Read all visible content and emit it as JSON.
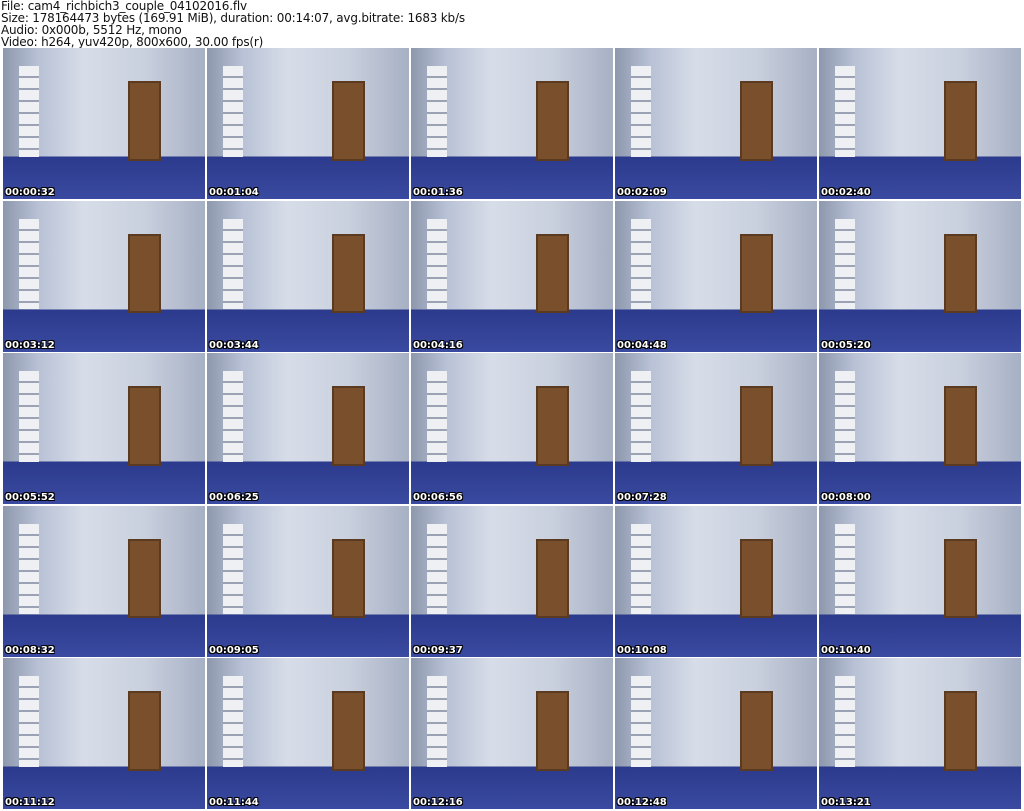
{
  "header": {
    "file": "File: cam4_richbich3_couple_04102016.flv",
    "size": "Size: 178164473 bytes (169.91 MiB), duration: 00:14:07, avg.bitrate: 1683 kb/s",
    "audio": "Audio: 0x000b, 5512 Hz, mono",
    "video": "Video: h264, yuv420p, 800x600, 30.00 fps(r)"
  },
  "timestamps": [
    "00:00:32",
    "00:01:04",
    "00:01:36",
    "00:02:09",
    "00:02:40",
    "00:03:12",
    "00:03:44",
    "00:04:16",
    "00:04:48",
    "00:05:20",
    "00:05:52",
    "00:06:25",
    "00:06:56",
    "00:07:28",
    "00:08:00",
    "00:08:32",
    "00:09:05",
    "00:09:37",
    "00:10:08",
    "00:10:40",
    "00:11:12",
    "00:11:44",
    "00:12:16",
    "00:12:48",
    "00:13:21"
  ]
}
